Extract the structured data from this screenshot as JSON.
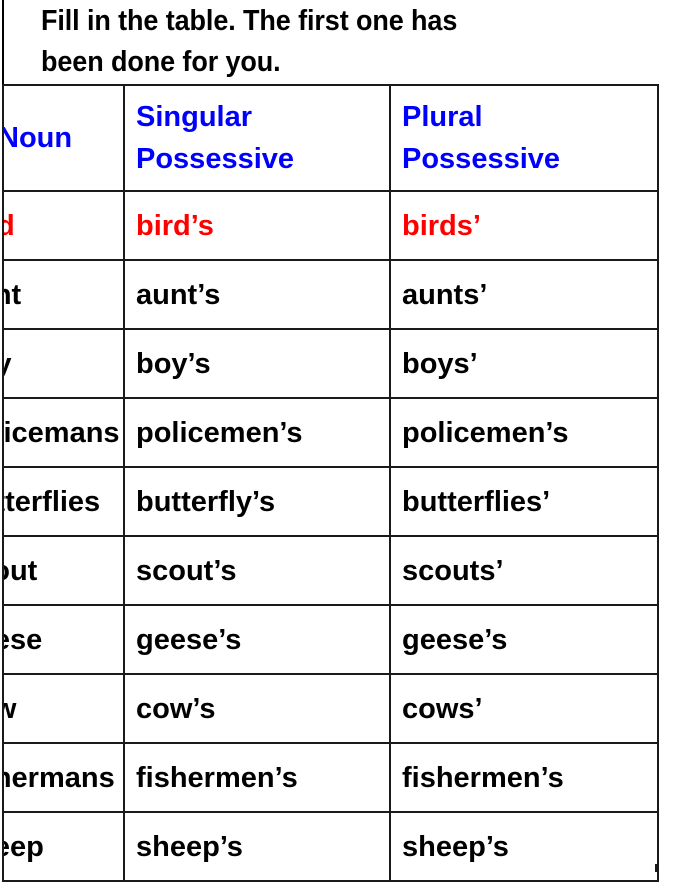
{
  "worksheet": {
    "instruction": {
      "line1": "Fill in the table. The first one has",
      "line2": "been done for you."
    },
    "colors": {
      "header_text": "#0000FF",
      "example_text": "#FF0000",
      "body_text": "#000000",
      "border": "#1A1A1A",
      "background": "#FFFFFF"
    },
    "table": {
      "headers": {
        "noun": "Noun",
        "singular_possessive": "Singular\nPossessive",
        "plural_possessive": "Plural\nPossessive"
      },
      "rows": [
        {
          "noun": "bird",
          "singular_possessive": "bird’s",
          "plural_possessive": "birds’",
          "is_example": true
        },
        {
          "noun": "aunt",
          "singular_possessive": "aunt’s",
          "plural_possessive": "aunts’",
          "is_example": false
        },
        {
          "noun": "boy",
          "singular_possessive": "boy’s",
          "plural_possessive": "boys’",
          "is_example": false
        },
        {
          "noun": "policemans",
          "singular_possessive": "policemen’s",
          "plural_possessive": "policemen’s",
          "is_example": false
        },
        {
          "noun": "butterflies",
          "singular_possessive": "butterfly’s",
          "plural_possessive": "butterflies’",
          "is_example": false
        },
        {
          "noun": "scout",
          "singular_possessive": "scout’s",
          "plural_possessive": "scouts’",
          "is_example": false
        },
        {
          "noun": "geese",
          "singular_possessive": "geese’s",
          "plural_possessive": "geese’s",
          "is_example": false
        },
        {
          "noun": "cow",
          "singular_possessive": "cow’s",
          "plural_possessive": "cows’",
          "is_example": false
        },
        {
          "noun": "fishermans",
          "singular_possessive": "fishermen’s",
          "plural_possessive": "fishermen’s",
          "is_example": false
        },
        {
          "noun": "sheep",
          "singular_possessive": "sheep’s",
          "plural_possessive": "sheep’s",
          "is_example": false
        }
      ]
    }
  }
}
